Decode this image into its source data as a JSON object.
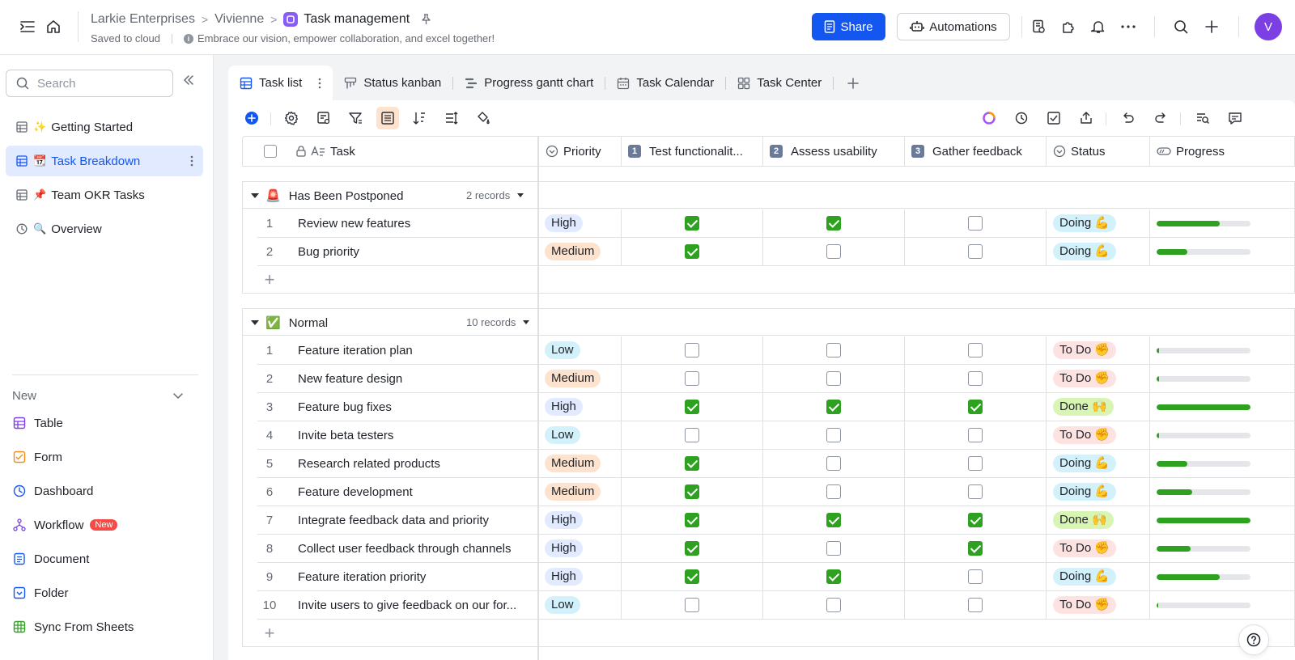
{
  "header": {
    "breadcrumb": [
      "Larkie Enterprises",
      "Vivienne",
      "Task management"
    ],
    "saved": "Saved to cloud",
    "slogan": "Embrace our vision, empower collaboration, and excel together!",
    "share_label": "Share",
    "automations_label": "Automations",
    "avatar_initial": "V"
  },
  "sidebar": {
    "search_placeholder": "Search",
    "items": [
      {
        "emoji": "✨",
        "label": "Getting Started"
      },
      {
        "emoji": "📆",
        "label": "Task Breakdown"
      },
      {
        "emoji": "📌",
        "label": "Team OKR Tasks"
      },
      {
        "emoji": "🔍",
        "label": "Overview"
      }
    ],
    "new_label": "New",
    "new_items": [
      "Table",
      "Form",
      "Dashboard",
      "Workflow",
      "Document",
      "Folder",
      "Sync From Sheets"
    ],
    "new_badge": "New"
  },
  "tabs": [
    "Task list",
    "Status kanban",
    "Progress gantt chart",
    "Task Calendar",
    "Task Center"
  ],
  "columns": {
    "task": "Task",
    "priority": "Priority",
    "col1": "Test functionalit...",
    "col1_num": "1",
    "col2": "Assess usability",
    "col2_num": "2",
    "col3": "Gather feedback",
    "col3_num": "3",
    "status": "Status",
    "progress": "Progress"
  },
  "priority_colors": {
    "High": "#e1eaff",
    "Medium": "#fde2cd",
    "Low": "#d3f1fa"
  },
  "status_colors": {
    "Doing 💪": "#d3f1fa",
    "To Do ✊": "#fde2e2",
    "Done 🙌": "#d9f5b4"
  },
  "groups": [
    {
      "emoji": "🚨",
      "name": "Has Been Postponed",
      "count": "2 records",
      "rows": [
        {
          "n": "1",
          "task": "Review new features",
          "priority": "High",
          "c1": true,
          "c2": true,
          "c3": false,
          "status": "Doing 💪",
          "progress": 0.67
        },
        {
          "n": "2",
          "task": "Bug priority",
          "priority": "Medium",
          "c1": true,
          "c2": false,
          "c3": false,
          "status": "Doing 💪",
          "progress": 0.33
        }
      ]
    },
    {
      "emoji": "✅",
      "name": "Normal",
      "count": "10 records",
      "rows": [
        {
          "n": "1",
          "task": "Feature iteration plan",
          "priority": "Low",
          "c1": false,
          "c2": false,
          "c3": false,
          "status": "To Do ✊",
          "progress": 0.03
        },
        {
          "n": "2",
          "task": "New feature design",
          "priority": "Medium",
          "c1": false,
          "c2": false,
          "c3": false,
          "status": "To Do ✊",
          "progress": 0.03
        },
        {
          "n": "3",
          "task": "Feature bug fixes",
          "priority": "High",
          "c1": true,
          "c2": true,
          "c3": true,
          "status": "Done 🙌",
          "progress": 1.0
        },
        {
          "n": "4",
          "task": "Invite beta testers",
          "priority": "Low",
          "c1": false,
          "c2": false,
          "c3": false,
          "status": "To Do ✊",
          "progress": 0.03
        },
        {
          "n": "5",
          "task": "Research related products",
          "priority": "Medium",
          "c1": true,
          "c2": false,
          "c3": false,
          "status": "Doing 💪",
          "progress": 0.33
        },
        {
          "n": "6",
          "task": "Feature development",
          "priority": "Medium",
          "c1": true,
          "c2": false,
          "c3": false,
          "status": "Doing 💪",
          "progress": 0.38
        },
        {
          "n": "7",
          "task": "Integrate feedback data and priority",
          "priority": "High",
          "c1": true,
          "c2": true,
          "c3": true,
          "status": "Done 🙌",
          "progress": 1.0
        },
        {
          "n": "8",
          "task": "Collect user feedback through channels",
          "priority": "High",
          "c1": true,
          "c2": false,
          "c3": true,
          "status": "To Do ✊",
          "progress": 0.36
        },
        {
          "n": "9",
          "task": "Feature iteration priority",
          "priority": "High",
          "c1": true,
          "c2": true,
          "c3": false,
          "status": "Doing 💪",
          "progress": 0.67
        },
        {
          "n": "10",
          "task": "Invite users to give feedback on our for...",
          "priority": "Low",
          "c1": false,
          "c2": false,
          "c3": false,
          "status": "To Do ✊",
          "progress": 0.02
        }
      ]
    }
  ]
}
